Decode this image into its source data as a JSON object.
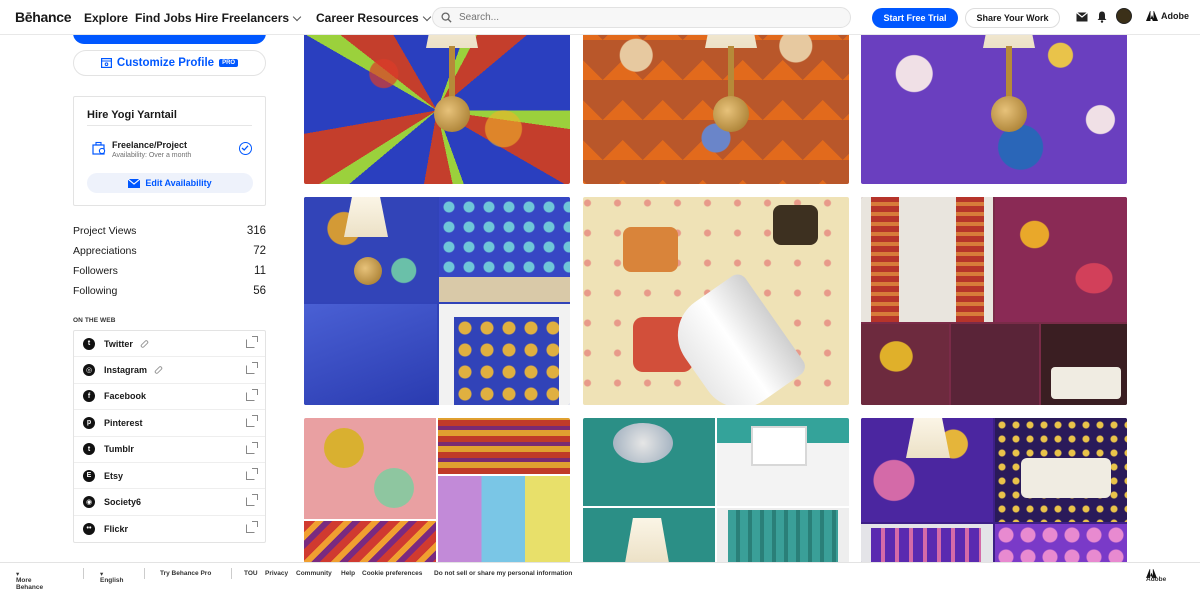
{
  "nav": {
    "logo": "Bēhance",
    "links": [
      "Explore",
      "Find Jobs",
      "Hire Freelancers",
      "Career Resources"
    ],
    "search_placeholder": "Search...",
    "start_trial": "Start Free Trial",
    "share_work": "Share Your Work",
    "adobe": "Adobe"
  },
  "sidebar": {
    "customize_label": "Customize Profile",
    "pro_badge": "PRO",
    "hire_title": "Hire Yogi Yarntail",
    "freelance_title": "Freelance/Project",
    "freelance_sub": "Availability: Over a month",
    "edit_availability": "Edit Availability",
    "stats": [
      {
        "label": "Project Views",
        "value": "316"
      },
      {
        "label": "Appreciations",
        "value": "72"
      },
      {
        "label": "Followers",
        "value": "11"
      },
      {
        "label": "Following",
        "value": "56"
      }
    ],
    "web_title": "ON THE WEB",
    "web_links": [
      {
        "label": "Twitter",
        "icon": "twitter-icon",
        "verified": true
      },
      {
        "label": "Instagram",
        "icon": "instagram-icon",
        "verified": true
      },
      {
        "label": "Facebook",
        "icon": "facebook-icon",
        "verified": false
      },
      {
        "label": "Pinterest",
        "icon": "pinterest-icon",
        "verified": false
      },
      {
        "label": "Tumblr",
        "icon": "tumblr-icon",
        "verified": false
      },
      {
        "label": "Etsy",
        "icon": "etsy-icon",
        "verified": false
      },
      {
        "label": "Society6",
        "icon": "society6-icon",
        "verified": false
      },
      {
        "label": "Flickr",
        "icon": "flickr-icon",
        "verified": false
      }
    ]
  },
  "footer": {
    "more": "More Behance",
    "lang": "English",
    "try_pro": "Try Behance Pro",
    "links": [
      "TOU",
      "Privacy",
      "Community",
      "Help",
      "Cookie preferences",
      "Do not sell or share my personal information"
    ],
    "adobe": "Adobe"
  },
  "colors": {
    "accent": "#0057ff"
  }
}
